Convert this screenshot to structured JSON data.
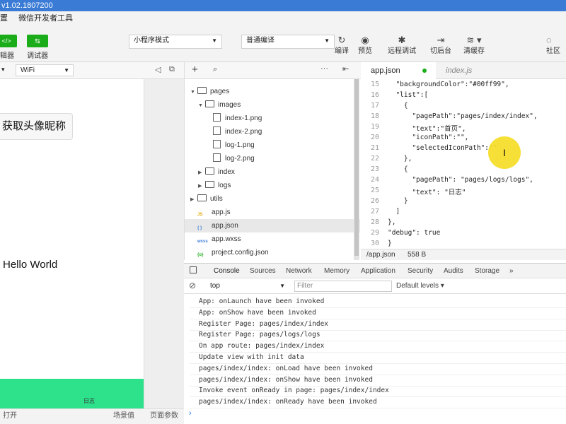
{
  "window": {
    "title": "v1.02.1807200"
  },
  "menu": [
    "置",
    "微信开发者工具"
  ],
  "toolbar": {
    "editor_label": "辑器",
    "debugger_label": "调试器",
    "mode_select": "小程序模式",
    "compile_select": "普通编译",
    "compile_label": "编译",
    "preview_label": "预览",
    "remote_debug_label": "远程调试",
    "background_label": "切后台",
    "clear_cache_label": "清缓存",
    "community_label": "社区"
  },
  "simulator": {
    "network": "WiFi",
    "get_avatar_button": "获取头像昵称",
    "hello_text": "Hello World",
    "tab_label": "日志",
    "footer": {
      "open": "打开",
      "scene": "场景值",
      "page_params": "页面参数"
    }
  },
  "explorer": {
    "items": [
      {
        "name": "pages",
        "type": "folder",
        "depth": 0,
        "expanded": true
      },
      {
        "name": "images",
        "type": "folder",
        "depth": 1,
        "expanded": true
      },
      {
        "name": "index-1.png",
        "type": "image",
        "depth": 2
      },
      {
        "name": "index-2.png",
        "type": "image",
        "depth": 2
      },
      {
        "name": "log-1.png",
        "type": "image",
        "depth": 2
      },
      {
        "name": "log-2.png",
        "type": "image",
        "depth": 2
      },
      {
        "name": "index",
        "type": "folder",
        "depth": 1,
        "expanded": false
      },
      {
        "name": "logs",
        "type": "folder",
        "depth": 1,
        "expanded": false
      },
      {
        "name": "utils",
        "type": "folder",
        "depth": 0,
        "expanded": false
      },
      {
        "name": "app.js",
        "type": "js",
        "depth": 0
      },
      {
        "name": "app.json",
        "type": "json",
        "depth": 0,
        "selected": true
      },
      {
        "name": "app.wxss",
        "type": "wxss",
        "depth": 0
      },
      {
        "name": "project.config.json",
        "type": "config",
        "depth": 0
      }
    ]
  },
  "editor": {
    "tabs": [
      {
        "label": "app.json",
        "modified": true,
        "active": true
      },
      {
        "label": "index.js",
        "modified": false,
        "active": false
      }
    ],
    "lines": [
      {
        "n": "15",
        "text": "  \"backgroundColor\":\"#00ff99\","
      },
      {
        "n": "16",
        "text": "  \"list\":["
      },
      {
        "n": "17",
        "text": "    {"
      },
      {
        "n": "18",
        "text": "      \"pagePath\":\"pages/index/index\","
      },
      {
        "n": "19",
        "text": "      \"text\":\"首页\","
      },
      {
        "n": "20",
        "text": "      \"iconPath\":\"\","
      },
      {
        "n": "21",
        "text": "      \"selectedIconPath\":\"\""
      },
      {
        "n": "22",
        "text": "    },"
      },
      {
        "n": "23",
        "text": "    {"
      },
      {
        "n": "24",
        "text": "      \"pagePath\": \"pages/logs/logs\","
      },
      {
        "n": "25",
        "text": "      \"text\": \"日志\""
      },
      {
        "n": "26",
        "text": "    }"
      },
      {
        "n": "27",
        "text": "  ]"
      },
      {
        "n": "28",
        "text": "},"
      },
      {
        "n": "29",
        "text": "\"debug\": true"
      },
      {
        "n": "30",
        "text": "}"
      }
    ],
    "status_path": "/app.json",
    "status_size": "558 B"
  },
  "devtools": {
    "tabs": [
      "Console",
      "Sources",
      "Network",
      "Memory",
      "Application",
      "Security",
      "Audits",
      "Storage"
    ],
    "more": "»",
    "context": "top",
    "filter_placeholder": "Filter",
    "levels": "Default levels",
    "logs": [
      "App: onLaunch have been invoked",
      "App: onShow have been invoked",
      "Register Page: pages/index/index",
      "Register Page: pages/logs/logs",
      "On app route: pages/index/index",
      "Update view with init data",
      "pages/index/index: onLoad have been invoked",
      "pages/index/index: onShow have been invoked",
      "Invoke event onReady in page: pages/index/index",
      "pages/index/index: onReady have been invoked"
    ]
  },
  "colors": {
    "accent": "#1aad19",
    "tabbar": "#2ee28c",
    "titlebar": "#3a7bd5"
  }
}
